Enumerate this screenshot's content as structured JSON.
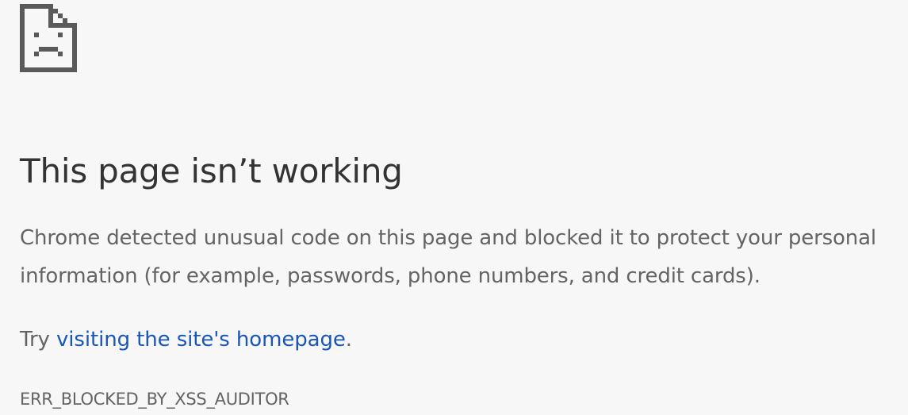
{
  "icon": {
    "name": "sad-document-icon",
    "color": "#5a5a5a"
  },
  "heading": "This page isn’t working",
  "message": "Chrome detected unusual code on this page and blocked it to protect your personal information (for example, passwords, phone numbers, and credit cards).",
  "suggestion": {
    "prefix": "Try ",
    "link_label": "visiting the site's homepage",
    "suffix": "."
  },
  "error_code": "ERR_BLOCKED_BY_XSS_AUDITOR",
  "colors": {
    "background": "#f7f7f7",
    "heading": "#333333",
    "body_text": "#646464",
    "link": "#1a55b8"
  }
}
